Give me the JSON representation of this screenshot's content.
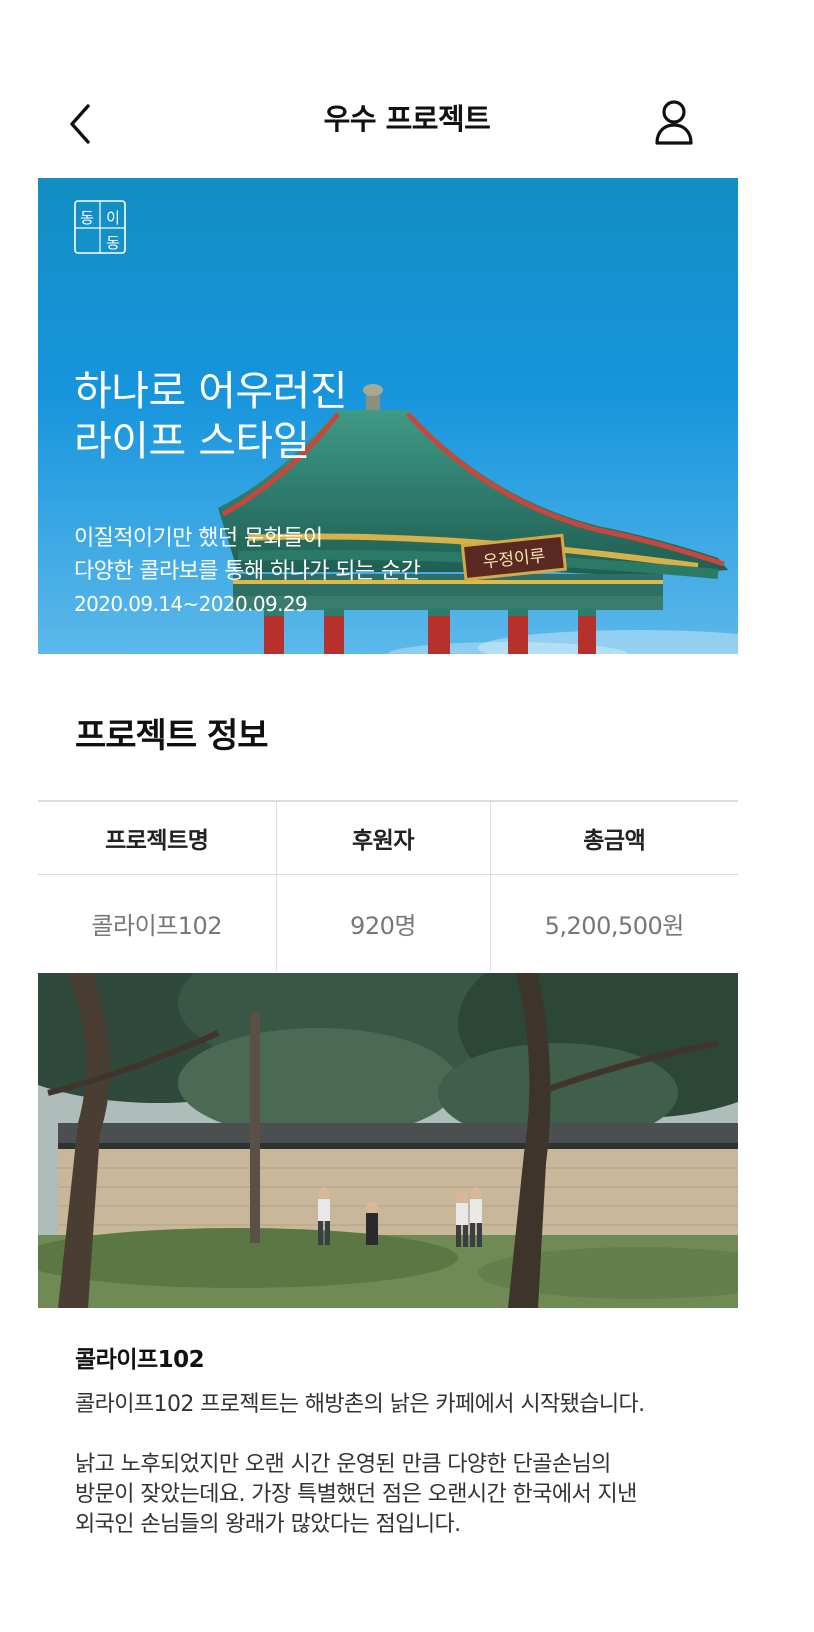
{
  "header": {
    "title": "우수 프로젝트",
    "back_icon": "chevron-left-icon",
    "user_icon": "user-icon"
  },
  "hero": {
    "logo_text": "동이동",
    "headline": [
      "하나로 어우러진",
      "라이프 스타일"
    ],
    "description": [
      "이질적이기만 했던 문화들이",
      "다양한 콜라보를 통해 하나가 되는 순간"
    ],
    "date_range": "2020.09.14~2020.09.29",
    "signboard": "우정이루",
    "colors": {
      "sky": "#1496de",
      "roof_green": "#2e7d6b",
      "pillar_red": "#b7312c"
    }
  },
  "project_info": {
    "section_title": "프로젝트 정보",
    "columns": [
      "프로젝트명",
      "후원자",
      "총금액"
    ],
    "values": [
      "콜라이프102",
      "920명",
      "5,200,500원"
    ]
  },
  "post": {
    "title": "콜라이프102",
    "paragraph1": [
      "콜라이프102 프로젝트는 해방촌의 낡은 카페에서 시작됐습니다."
    ],
    "paragraph2": [
      "낡고 노후되었지만 오랜 시간 운영된 만큼 다양한 단골손님의",
      "방문이 잦았는데요. 가장 특별했던 점은 오랜시간 한국에서 지낸",
      "외국인 손님들의 왕래가 많았다는 점입니다."
    ]
  }
}
